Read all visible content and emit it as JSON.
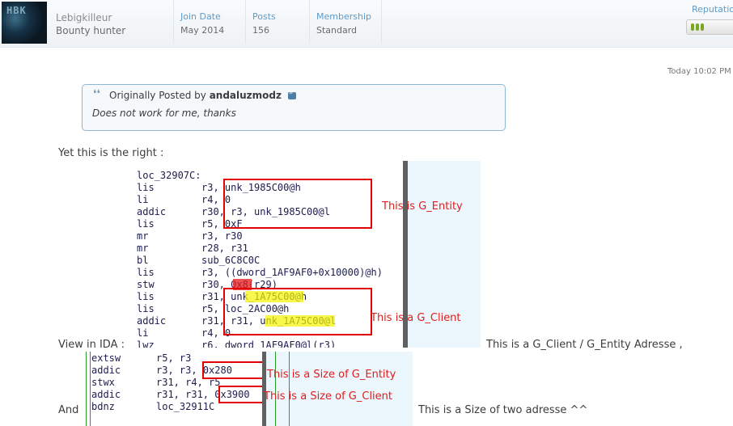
{
  "user": {
    "avatar_text": "HBK",
    "username": "Lebigkilleur",
    "title": "Bounty hunter",
    "stats": [
      {
        "label": "Join Date",
        "value": "May 2014"
      },
      {
        "label": "Posts",
        "value": "156"
      },
      {
        "label": "Membership",
        "value": "Standard"
      }
    ],
    "reputation_label": "Reputation",
    "reputation_pips": 3
  },
  "post": {
    "timestamp": "Today 10:02 PM",
    "quote": {
      "prefix": "Originally Posted by",
      "author": "andaluzmodz",
      "text": "Does not work for me, thanks"
    },
    "line_right": "Yet this is the right :",
    "line_view": "View in IDA :",
    "line_adresse": "This is a G_Client / G_Entity Adresse ,",
    "line_and": "And",
    "line_size": "This is a Size of two adresse ^^"
  },
  "ida_block_1": {
    "label": "loc_32907C:",
    "lines": [
      {
        "op": "lis",
        "args": "r3, unk_1985C00@h"
      },
      {
        "op": "li",
        "args": "r4, 0"
      },
      {
        "op": "addic",
        "args": "r30, r3, unk_1985C00@l"
      },
      {
        "op": "lis",
        "args": "r5, 0xF"
      },
      {
        "op": "mr",
        "args": "r3, r30"
      },
      {
        "op": "mr",
        "args": "r28, r31"
      },
      {
        "op": "bl",
        "args": "sub_6C8C0C"
      },
      {
        "op": "lis",
        "args": "r3, ((dword_1AF9AF0+0x10000)@h)"
      },
      {
        "op": "stw",
        "args": "r30, 0x8(r29)"
      },
      {
        "op": "lis",
        "args": "r31, unk_1A75C00@h"
      },
      {
        "op": "lis",
        "args": "r5, loc_2AC00@h"
      },
      {
        "op": "addic",
        "args": "r31, r31, unk_1A75C00@l"
      },
      {
        "op": "li",
        "args": "r4, 0"
      },
      {
        "op": "lwz",
        "args": "r6, dword_1AF9AF0@l(r3)"
      }
    ],
    "note_entity": "This is G_Entity",
    "note_client": "This is a G_Client"
  },
  "ida_block_2": {
    "lines": [
      {
        "op": "extsw",
        "args": "r5, r3"
      },
      {
        "op": "addic",
        "args": "r3, r3, 0x280"
      },
      {
        "op": "stwx",
        "args": "r31, r4, r5"
      },
      {
        "op": "addic",
        "args": "r31, r31, 0x3900"
      },
      {
        "op": "bdnz",
        "args": "loc_32911C"
      }
    ],
    "note_entity_size": "This is a Size of G_Entity",
    "note_client_size": "This is a Size of G_Client"
  }
}
